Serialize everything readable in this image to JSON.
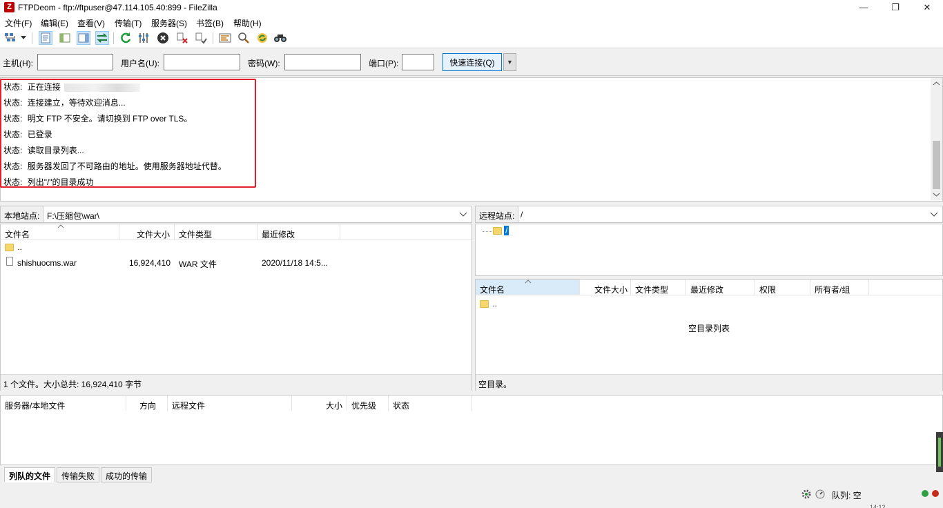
{
  "window": {
    "title": "FTPDeom - ftp://ftpuser@47.114.105.40:899 - FileZilla",
    "app_icon_glyph": "Z",
    "minimize_glyph": "—",
    "restore_glyph": "❐",
    "close_glyph": "✕"
  },
  "menu": [
    {
      "label": "文件(F)"
    },
    {
      "label": "编辑(E)"
    },
    {
      "label": "查看(V)"
    },
    {
      "label": "传输(T)"
    },
    {
      "label": "服务器(S)"
    },
    {
      "label": "书签(B)"
    },
    {
      "label": "帮助(H)"
    }
  ],
  "toolbar": {
    "icons": [
      "site-manager-icon",
      "dropdown-arrow-icon",
      "toggle-log-icon",
      "toggle-local-tree-icon",
      "toggle-remote-tree-icon",
      "toggle-queue-icon",
      "refresh-icon",
      "process-queue-icon",
      "cancel-icon",
      "disconnect-icon",
      "reconnect-icon",
      "directory-compare-icon",
      "filter-icon",
      "sync-browse-icon",
      "search-icon"
    ]
  },
  "quickconnect": {
    "host_label": "主机(H):",
    "user_label": "用户名(U):",
    "pass_label": "密码(W):",
    "port_label": "端口(P):",
    "host_value": "",
    "user_value": "",
    "pass_value": "",
    "port_value": "",
    "connect_label": "快速连接(Q)",
    "dropdown_glyph": "▼"
  },
  "log": [
    {
      "prefix": "状态:",
      "text": "正在连接"
    },
    {
      "prefix": "状态:",
      "text": "连接建立，等待欢迎消息..."
    },
    {
      "prefix": "状态:",
      "text": "明文 FTP 不安全。请切换到 FTP over TLS。"
    },
    {
      "prefix": "状态:",
      "text": "已登录"
    },
    {
      "prefix": "状态:",
      "text": "读取目录列表..."
    },
    {
      "prefix": "状态:",
      "text": "服务器发回了不可路由的地址。使用服务器地址代替。"
    },
    {
      "prefix": "状态:",
      "text": "列出\"/\"的目录成功"
    }
  ],
  "local": {
    "site_label": "本地站点:",
    "path": "F:\\压缩包\\war\\",
    "columns": [
      "文件名",
      "文件大小",
      "文件类型",
      "最近修改"
    ],
    "rows": [
      {
        "name": "..",
        "size": "",
        "type": "",
        "modified": "",
        "kind": "folder"
      },
      {
        "name": "shishuocms.war",
        "size": "16,924,410",
        "type": "WAR 文件",
        "modified": "2020/11/18 14:5...",
        "kind": "file"
      }
    ],
    "status": "1 个文件。大小总共: 16,924,410 字节"
  },
  "remote": {
    "site_label": "远程站点:",
    "path": "/",
    "tree_root": "/",
    "columns": [
      "文件名",
      "文件大小",
      "文件类型",
      "最近修改",
      "权限",
      "所有者/组"
    ],
    "rows": [
      {
        "name": "..",
        "kind": "folder"
      }
    ],
    "empty_message": "空目录列表",
    "status": "空目录。"
  },
  "queue": {
    "columns": [
      "服务器/本地文件",
      "方向",
      "远程文件",
      "大小",
      "优先级",
      "状态"
    ],
    "tabs": [
      "列队的文件",
      "传输失败",
      "成功的传输"
    ],
    "active_tab": 0
  },
  "statusbar": {
    "queue_label": "队列: 空",
    "clock_partial": "14:12"
  },
  "colors": {
    "highlight_border": "#e0202a",
    "accent": "#0078d7",
    "led_green": "#2ea043",
    "led_red": "#c42b1c"
  }
}
